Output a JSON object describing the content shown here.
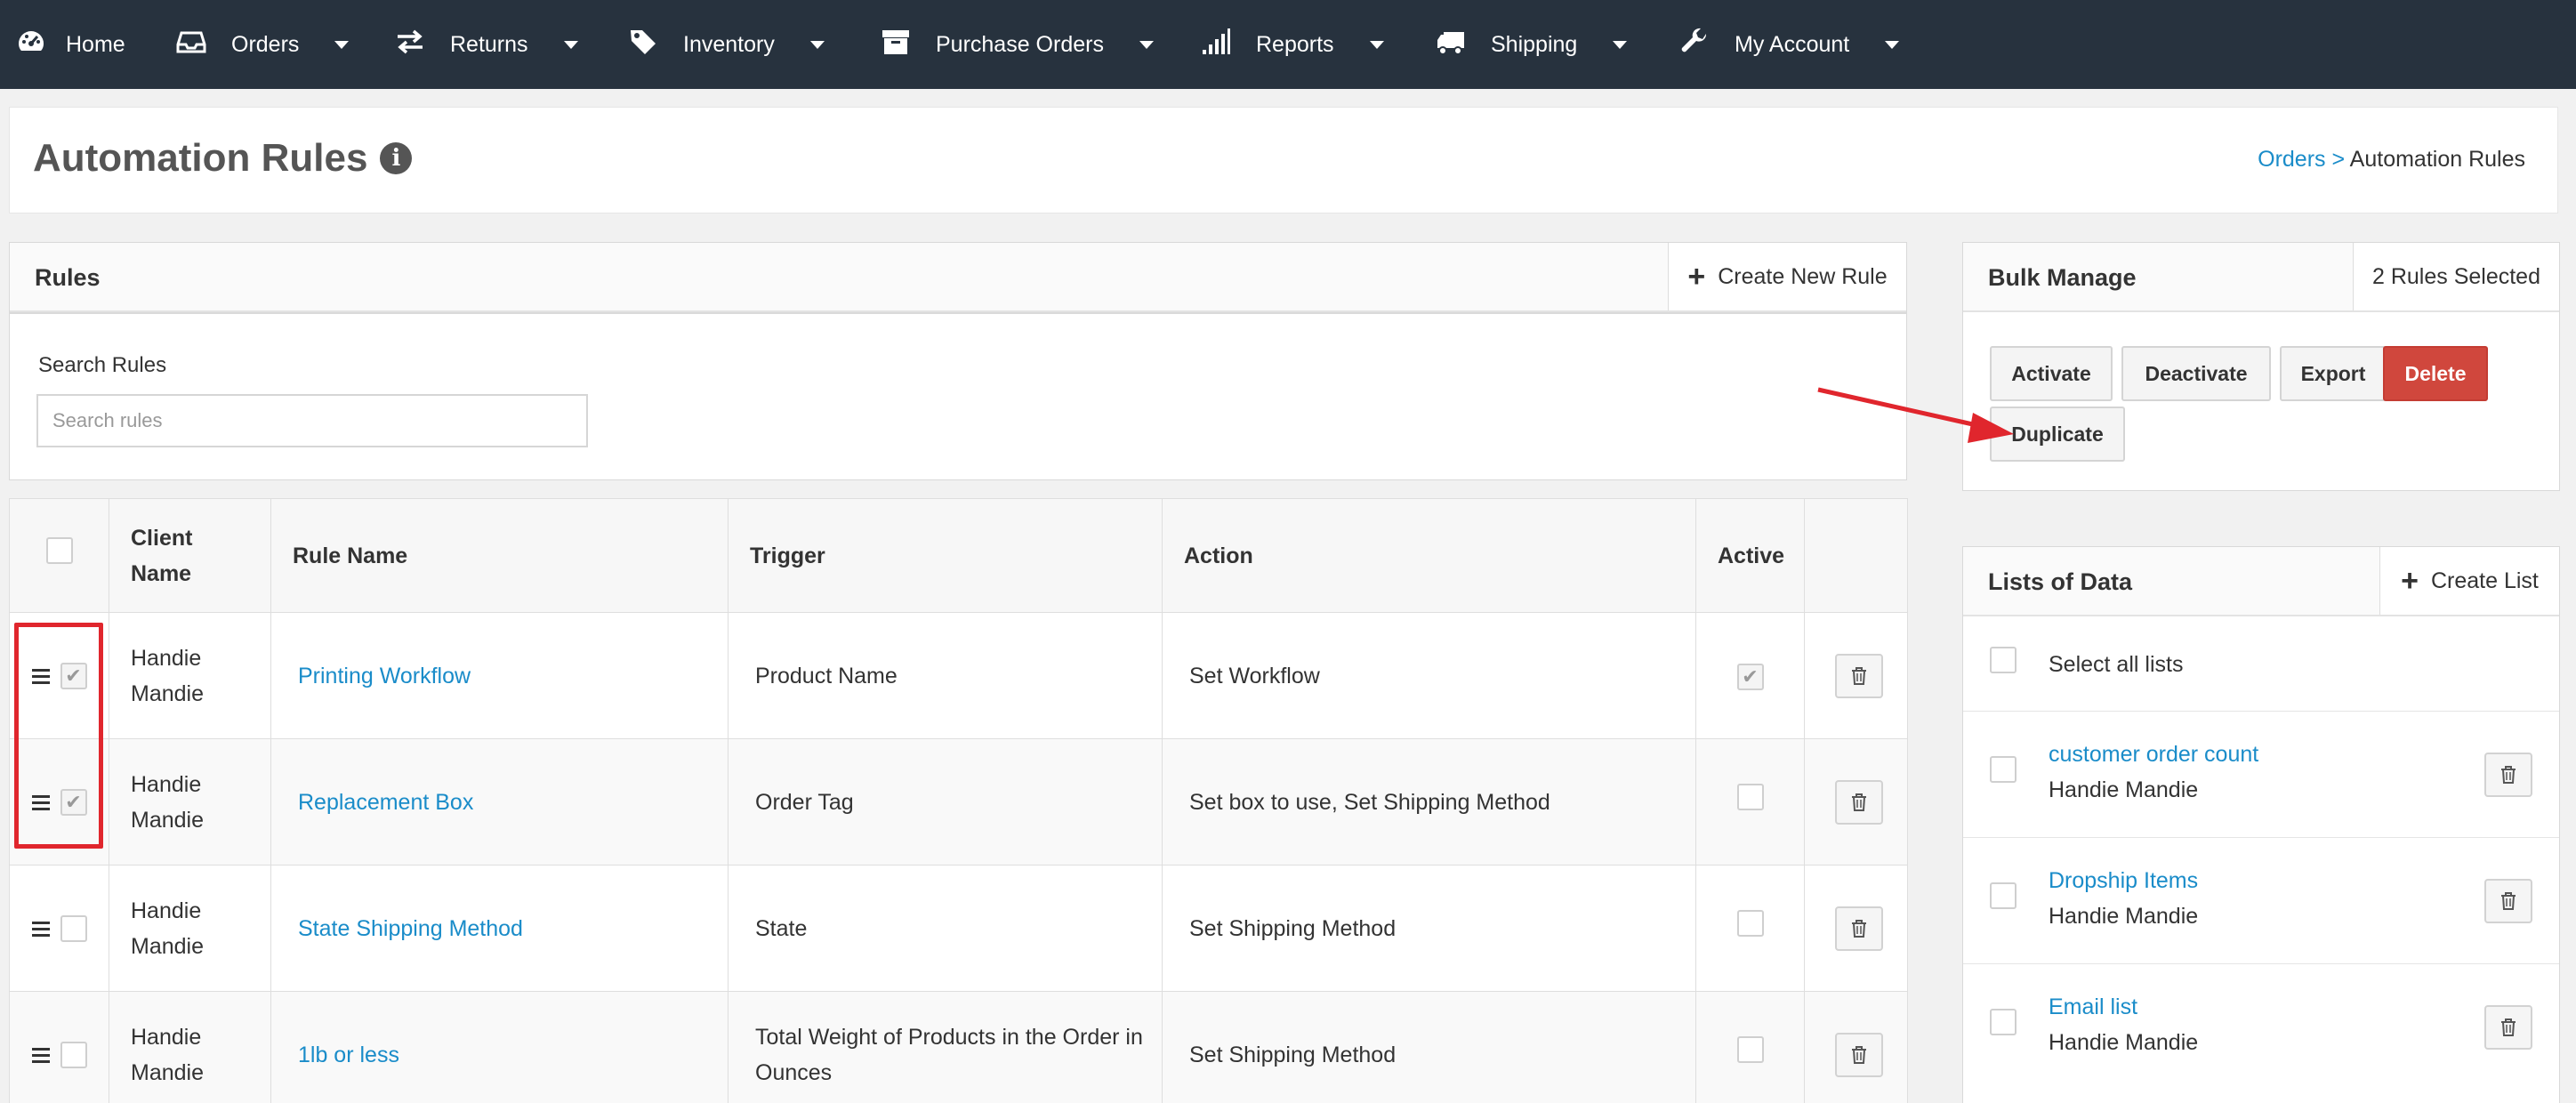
{
  "nav": {
    "items": [
      {
        "label": "Home",
        "icon": "dashboard-icon",
        "has_caret": false
      },
      {
        "label": "Orders",
        "icon": "inbox-icon",
        "has_caret": true
      },
      {
        "label": "Returns",
        "icon": "exchange-icon",
        "has_caret": true
      },
      {
        "label": "Inventory",
        "icon": "tags-icon",
        "has_caret": true
      },
      {
        "label": "Purchase Orders",
        "icon": "archive-icon",
        "has_caret": true
      },
      {
        "label": "Reports",
        "icon": "signal-icon",
        "has_caret": true
      },
      {
        "label": "Shipping",
        "icon": "truck-icon",
        "has_caret": true
      },
      {
        "label": "My Account",
        "icon": "wrench-icon",
        "has_caret": true
      }
    ]
  },
  "page": {
    "title": "Automation Rules",
    "breadcrumb_link": "Orders",
    "breadcrumb_sep": ">",
    "breadcrumb_current": "Automation Rules"
  },
  "rules_panel": {
    "title": "Rules",
    "create_label": "Create New Rule"
  },
  "search": {
    "label": "Search Rules",
    "placeholder": "Search rules",
    "value": ""
  },
  "table": {
    "headers": {
      "client": "Client Name",
      "rule_name": "Rule Name",
      "trigger": "Trigger",
      "action": "Action",
      "active": "Active"
    },
    "rows": [
      {
        "client": "Handie Mandie",
        "rule_name": "Printing Workflow",
        "trigger": "Product Name",
        "action": "Set Workflow",
        "selected": true,
        "active": true
      },
      {
        "client": "Handie Mandie",
        "rule_name": "Replacement Box",
        "trigger": "Order Tag",
        "action": "Set box to use, Set Shipping Method",
        "selected": true,
        "active": false
      },
      {
        "client": "Handie Mandie",
        "rule_name": "State Shipping Method",
        "trigger": "State",
        "action": "Set Shipping Method",
        "selected": false,
        "active": false
      },
      {
        "client": "Handie Mandie",
        "rule_name": "1lb or less",
        "trigger": "Total Weight of Products in the Order in Ounces",
        "action": "Set Shipping Method",
        "selected": false,
        "active": false
      }
    ]
  },
  "bulk": {
    "title": "Bulk Manage",
    "selected_text": "2 Rules Selected",
    "buttons": {
      "activate": "Activate",
      "deactivate": "Deactivate",
      "export": "Export",
      "delete": "Delete",
      "duplicate": "Duplicate"
    }
  },
  "lists": {
    "title": "Lists of Data",
    "create_label": "Create List",
    "select_all_label": "Select all lists",
    "items": [
      {
        "name": "customer order count",
        "client": "Handie Mandie"
      },
      {
        "name": "Dropship Items",
        "client": "Handie Mandie"
      },
      {
        "name": "Email list",
        "client": "Handie Mandie"
      }
    ]
  },
  "colors": {
    "nav_bg": "#27323e",
    "link": "#1a8cc9",
    "danger": "#d0473d",
    "annotation": "#e0262d"
  }
}
